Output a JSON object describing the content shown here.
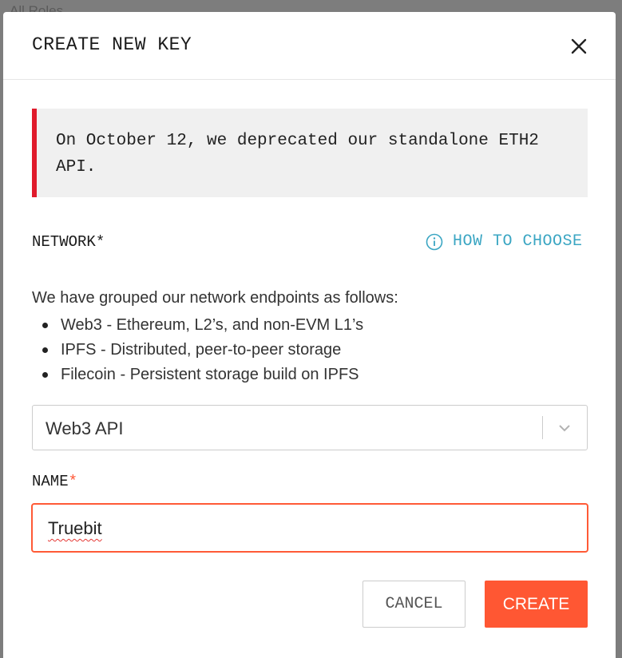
{
  "backdrop": {
    "filter_label": "All Roles"
  },
  "modal": {
    "title": "CREATE NEW KEY",
    "close_icon": "close-icon",
    "notice": {
      "text": "On October 12, we deprecated our standalone ETH2 API.",
      "accent_color": "#e01a2b"
    },
    "network": {
      "label": "NETWORK*",
      "help_link": "HOW TO CHOOSE",
      "help_icon": "info-icon",
      "description": "We have grouped our network endpoints as follows:",
      "options_list": [
        "Web3 - Ethereum, L2’s, and non-EVM L1’s",
        "IPFS - Distributed, peer-to-peer storage",
        "Filecoin - Persistent storage build on IPFS"
      ],
      "selected": "Web3 API",
      "dropdown_icon": "chevron-down-icon"
    },
    "name": {
      "label": "NAME",
      "required_mark": "*",
      "value": "Truebit"
    },
    "actions": {
      "cancel_label": "CANCEL",
      "create_label": "CREATE"
    }
  },
  "colors": {
    "accent": "#ff5733",
    "link": "#3ba6c3",
    "input_focus_border": "#ff5a36"
  }
}
